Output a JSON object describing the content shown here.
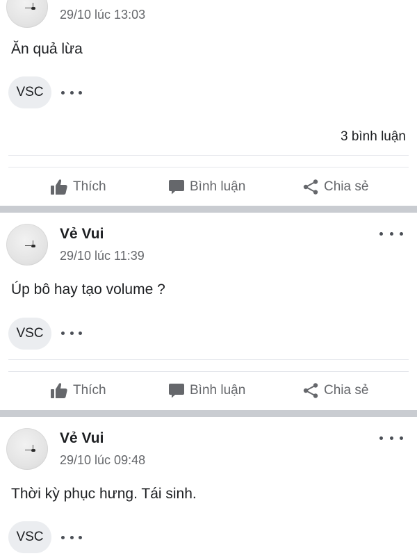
{
  "posts": [
    {
      "author": "",
      "timestamp": "29/10 lúc 13:03",
      "text": "Ăn quả lừa",
      "chip": "VSC",
      "comments": "3 bình luận"
    },
    {
      "author": "Vẻ Vui",
      "timestamp": "29/10 lúc 11:39",
      "text": "Úp bô hay tạo volume ?",
      "chip": "VSC"
    },
    {
      "author": "Vẻ Vui",
      "timestamp": "29/10 lúc 09:48",
      "text": "Thời kỳ phục hưng. Tái sinh.",
      "chip": "VSC"
    }
  ],
  "actions": {
    "like": "Thích",
    "comment": "Bình luận",
    "share": "Chia sẻ"
  },
  "colors": {
    "separator": "#c9ccd1",
    "action_text": "#65676b",
    "chip_bg": "#ebedf0"
  },
  "icons": {
    "like": "thumbs-up-icon",
    "comment": "speech-bubble-icon",
    "share": "share-icon",
    "more": "more-dots-icon"
  }
}
